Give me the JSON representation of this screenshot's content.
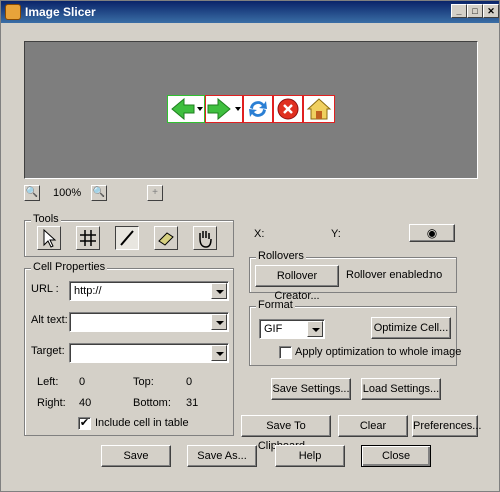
{
  "window": {
    "title": "Image Slicer",
    "minimize": "_",
    "maximize": "□",
    "close": "✕"
  },
  "zoom": {
    "level": "100%",
    "zoom_out_icon": "zoom-out-icon",
    "zoom_in_icon": "zoom-in-icon",
    "add_icon": "add-slice-icon"
  },
  "tools": {
    "label": "Tools",
    "items": [
      "pointer-tool-icon",
      "grid-tool-icon",
      "slice-tool-icon",
      "eraser-tool-icon",
      "hand-tool-icon"
    ]
  },
  "coords": {
    "x_label": "X:",
    "y_label": "Y:",
    "preview_icon": "eye-icon"
  },
  "cell_properties": {
    "label": "Cell Properties",
    "url_label": "URL :",
    "url_value": "http://",
    "alt_label": "Alt text:",
    "alt_value": "",
    "target_label": "Target:",
    "target_value": "",
    "left_label": "Left:",
    "left_value": "0",
    "top_label": "Top:",
    "top_value": "0",
    "right_label": "Right:",
    "right_value": "40",
    "bottom_label": "Bottom:",
    "bottom_value": "31",
    "include_label": "Include cell in table",
    "include_checked": "✔"
  },
  "rollovers": {
    "label": "Rollovers",
    "creator_button": "Rollover Creator...",
    "enabled_label": "Rollover enabled:",
    "enabled_value": "no"
  },
  "format": {
    "label": "Format",
    "selected": "GIF",
    "optimize_button": "Optimize Cell...",
    "apply_label": "Apply optimization to whole image"
  },
  "settings": {
    "save": "Save Settings...",
    "load": "Load Settings..."
  },
  "actions": {
    "clipboard": "Save To Clipboard...",
    "clear": "Clear",
    "preferences": "Preferences..."
  },
  "footer": {
    "save": "Save",
    "save_as": "Save As...",
    "help": "Help",
    "close": "Close"
  }
}
